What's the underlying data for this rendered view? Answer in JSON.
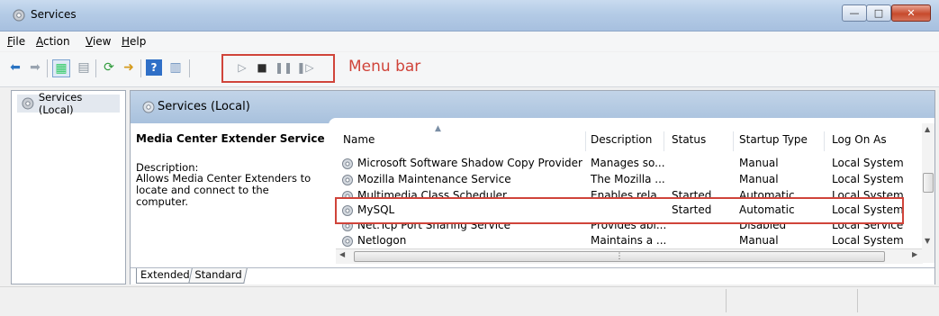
{
  "window": {
    "title": "Services"
  },
  "menu": [
    {
      "label": "File",
      "accel": "F"
    },
    {
      "label": "Action",
      "accel": "A"
    },
    {
      "label": "View",
      "accel": "V"
    },
    {
      "label": "Help",
      "accel": "H"
    }
  ],
  "annotation": {
    "label": "Menu bar",
    "color": "#d0443a"
  },
  "tree": {
    "item": "Services (Local)"
  },
  "pane": {
    "header": "Services (Local)",
    "service_name": "Media Center Extender Service",
    "description_label": "Description:",
    "description_text": "Allows Media Center Extenders to locate and connect to the computer."
  },
  "table": {
    "columns": [
      "Name",
      "Description",
      "Status",
      "Startup Type",
      "Log On As"
    ],
    "rows": [
      {
        "name": "Microsoft Software Shadow Copy Provider",
        "description": "Manages so...",
        "status": "",
        "startup": "Manual",
        "logon": "Local System"
      },
      {
        "name": "Mozilla Maintenance Service",
        "description": "The Mozilla ...",
        "status": "",
        "startup": "Manual",
        "logon": "Local System"
      },
      {
        "name": "Multimedia Class Scheduler",
        "description": "Enables rela...",
        "status": "Started",
        "startup": "Automatic",
        "logon": "Local System"
      },
      {
        "name": "MySQL",
        "description": "",
        "status": "Started",
        "startup": "Automatic",
        "logon": "Local System"
      },
      {
        "name": "Net.Tcp Port Sharing Service",
        "description": "Provides abi...",
        "status": "",
        "startup": "Disabled",
        "logon": "Local Service"
      },
      {
        "name": "Netlogon",
        "description": "Maintains a ...",
        "status": "",
        "startup": "Manual",
        "logon": "Local System"
      }
    ]
  },
  "tabs": [
    "Extended",
    "Standard"
  ],
  "colors": {
    "highlight_box": "#d0443a",
    "header_band": "#b3c9e2"
  }
}
